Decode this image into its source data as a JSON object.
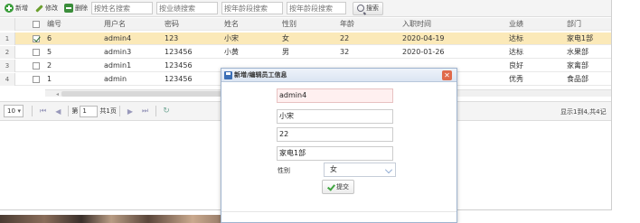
{
  "toolbar": {
    "add_label": "新增",
    "edit_label": "修改",
    "delete_label": "删除",
    "search_name_placeholder": "按姓名搜索",
    "search_perf_placeholder": "按业绩搜索",
    "search_age_min_placeholder": "按年龄段搜索",
    "search_age_max_placeholder": "按年龄段搜索",
    "search_button_label": "搜索"
  },
  "grid": {
    "columns": [
      "编号",
      "用户名",
      "密码",
      "姓名",
      "性别",
      "年龄",
      "入职时间",
      "业绩",
      "部门"
    ],
    "rows": [
      {
        "num": "1",
        "checked": true,
        "cells": [
          "6",
          "admin4",
          "123",
          "小宋",
          "女",
          "22",
          "2020-04-19",
          "达标",
          "家电1部"
        ]
      },
      {
        "num": "2",
        "checked": false,
        "cells": [
          "5",
          "admin3",
          "123456",
          "小黄",
          "男",
          "32",
          "2020-01-26",
          "达标",
          "水果部"
        ]
      },
      {
        "num": "3",
        "checked": false,
        "cells": [
          "2",
          "admin1",
          "123456",
          "",
          "",
          "",
          "",
          "良好",
          "家禽部"
        ]
      },
      {
        "num": "4",
        "checked": false,
        "cells": [
          "1",
          "admin",
          "123456",
          "",
          "",
          "",
          "",
          "优秀",
          "食品部"
        ]
      }
    ]
  },
  "pager": {
    "page_size": "10",
    "page_prefix": "第",
    "page_value": "1",
    "page_total": "共1页",
    "info": "显示1到4,共4记"
  },
  "dialog": {
    "title": "新增/编辑员工信息",
    "username": "admin4",
    "name": "小宋",
    "age": "22",
    "department": "家电1部",
    "gender_label": "性别",
    "gender_value": "女",
    "submit_label": "提交"
  }
}
